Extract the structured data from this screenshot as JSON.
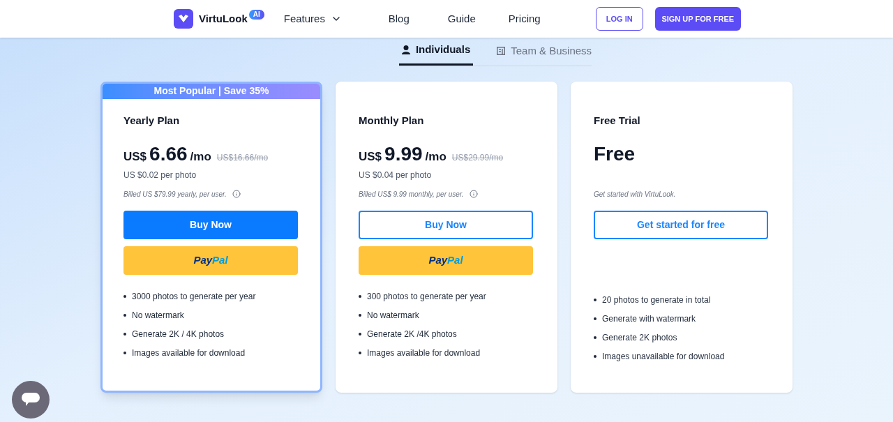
{
  "header": {
    "brand": "VirtuLook",
    "brand_badge": "AI",
    "nav": [
      {
        "label": "Features",
        "kind": "dropdown"
      },
      {
        "label": "Blog",
        "kind": "link"
      },
      {
        "label": "Guide",
        "kind": "link"
      },
      {
        "label": "Pricing",
        "kind": "link"
      }
    ],
    "login": "LOG IN",
    "signup": "SIGN UP FOR FREE"
  },
  "tabs": [
    {
      "label": "Individuals",
      "selected": true
    },
    {
      "label": "Team & Business",
      "selected": false
    }
  ],
  "plans": [
    {
      "featured": true,
      "banner": "Most Popular | Save 35%",
      "name": "Yearly Plan",
      "currency": "US$",
      "price": "6.66",
      "unit": "/mo",
      "old_price": "US$16.66/mo",
      "per_photo": "US $0.02 per photo",
      "billing": "Billed US $79.99 yearly, per user.",
      "info": true,
      "button": {
        "label": "Buy Now",
        "kind": "solid"
      },
      "paypal": {
        "pay": "Pay",
        "pal": "Pal"
      },
      "features": [
        "3000 photos to generate per year",
        "No watermark",
        "Generate 2K / 4K photos",
        "Images available for download"
      ]
    },
    {
      "featured": false,
      "name": "Monthly Plan",
      "currency": "US$",
      "price": "9.99",
      "unit": "/mo",
      "old_price": "US$29.99/mo",
      "per_photo": "US $0.04 per photo",
      "billing": "Billed US$ 9.99 monthly, per user.",
      "info": true,
      "button": {
        "label": "Buy Now",
        "kind": "outline"
      },
      "paypal": {
        "pay": "Pay",
        "pal": "Pal"
      },
      "features": [
        "300 photos to generate per year",
        "No watermark",
        "Generate 2K /4K photos",
        "Images available for download"
      ]
    },
    {
      "featured": false,
      "name": "Free Trial",
      "price": "Free",
      "billing": "Get started with VirtuLook.",
      "info": false,
      "button": {
        "label": "Get started for free",
        "kind": "outline"
      },
      "features": [
        "20 photos to generate in total",
        "Generate with watermark",
        "Generate 2K photos",
        "Images unavailable for download"
      ]
    }
  ]
}
